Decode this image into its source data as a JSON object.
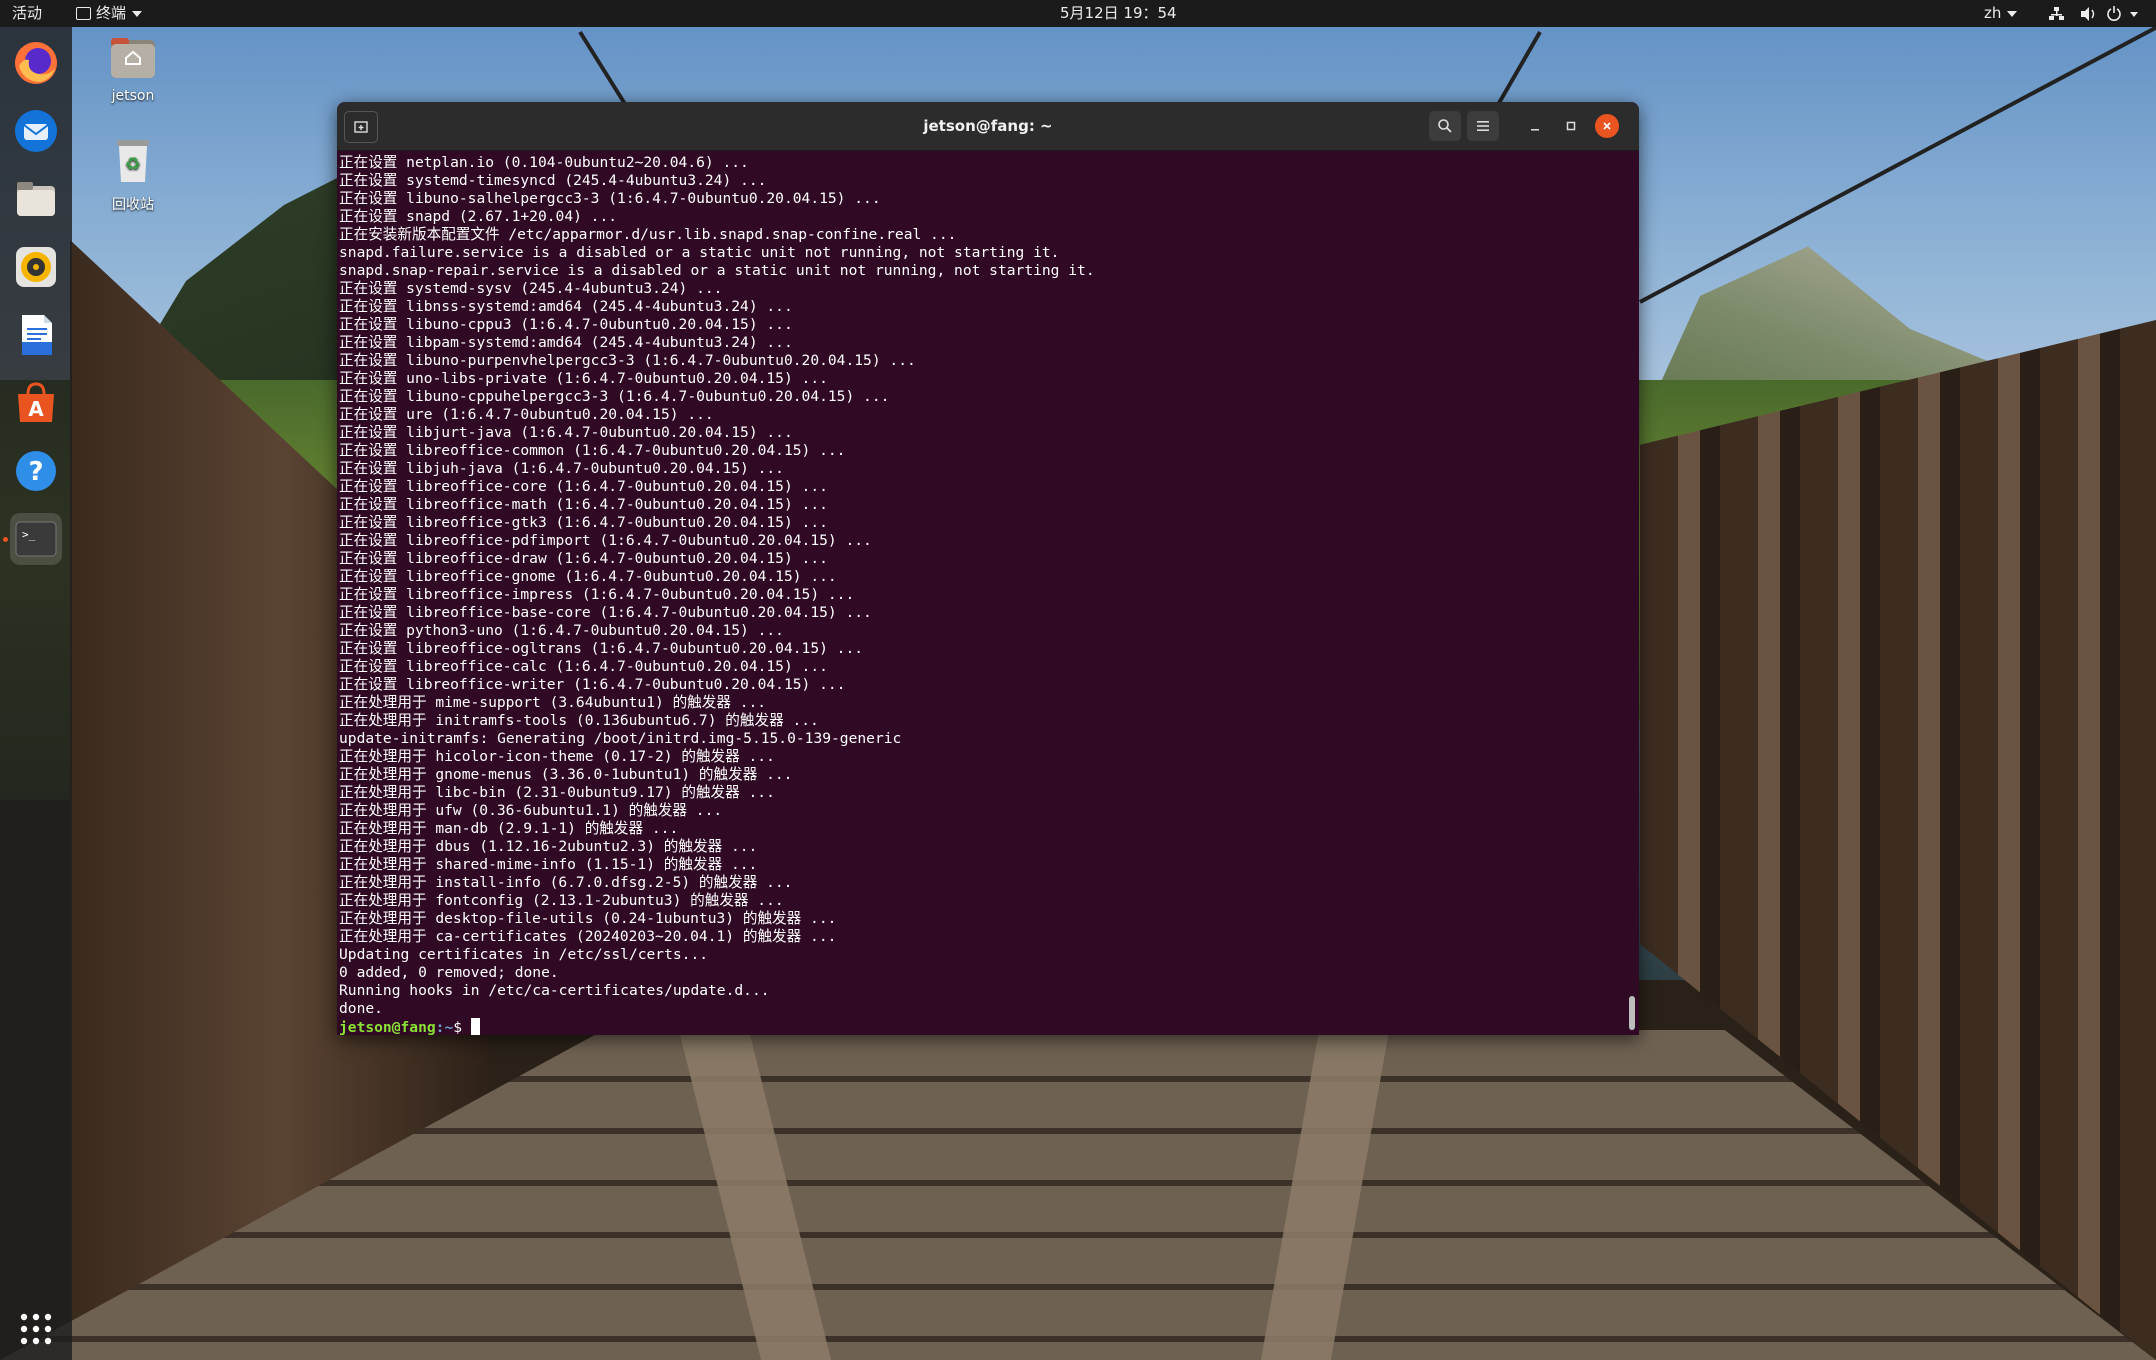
{
  "topbar": {
    "activities": "活动",
    "app_menu": "终端",
    "clock": "5月12日  19：54",
    "input_method": "zh"
  },
  "dock": {
    "items": [
      {
        "name": "firefox",
        "icon": "firefox-icon"
      },
      {
        "name": "thunderbird",
        "icon": "thunderbird-icon"
      },
      {
        "name": "files",
        "icon": "files-icon"
      },
      {
        "name": "rhythmbox",
        "icon": "rhythmbox-icon"
      },
      {
        "name": "libreoffice-writer",
        "icon": "writer-icon"
      },
      {
        "name": "ubuntu-software",
        "icon": "software-icon"
      },
      {
        "name": "help",
        "icon": "help-icon"
      },
      {
        "name": "terminal",
        "icon": "terminal-icon",
        "running": true
      }
    ],
    "show_apps": "apps-grid-icon"
  },
  "desktop": {
    "home_label": "jetson",
    "trash_label": "回收站"
  },
  "terminal": {
    "title": "jetson@fang: ~",
    "lines": [
      "正在设置 netplan.io (0.104-0ubuntu2~20.04.6) ...",
      "正在设置 systemd-timesyncd (245.4-4ubuntu3.24) ...",
      "正在设置 libuno-salhelpergcc3-3 (1:6.4.7-0ubuntu0.20.04.15) ...",
      "正在设置 snapd (2.67.1+20.04) ...",
      "正在安装新版本配置文件 /etc/apparmor.d/usr.lib.snapd.snap-confine.real ...",
      "snapd.failure.service is a disabled or a static unit not running, not starting it.",
      "snapd.snap-repair.service is a disabled or a static unit not running, not starting it.",
      "正在设置 systemd-sysv (245.4-4ubuntu3.24) ...",
      "正在设置 libnss-systemd:amd64 (245.4-4ubuntu3.24) ...",
      "正在设置 libuno-cppu3 (1:6.4.7-0ubuntu0.20.04.15) ...",
      "正在设置 libpam-systemd:amd64 (245.4-4ubuntu3.24) ...",
      "正在设置 libuno-purpenvhelpergcc3-3 (1:6.4.7-0ubuntu0.20.04.15) ...",
      "正在设置 uno-libs-private (1:6.4.7-0ubuntu0.20.04.15) ...",
      "正在设置 libuno-cppuhelpergcc3-3 (1:6.4.7-0ubuntu0.20.04.15) ...",
      "正在设置 ure (1:6.4.7-0ubuntu0.20.04.15) ...",
      "正在设置 libjurt-java (1:6.4.7-0ubuntu0.20.04.15) ...",
      "正在设置 libreoffice-common (1:6.4.7-0ubuntu0.20.04.15) ...",
      "正在设置 libjuh-java (1:6.4.7-0ubuntu0.20.04.15) ...",
      "正在设置 libreoffice-core (1:6.4.7-0ubuntu0.20.04.15) ...",
      "正在设置 libreoffice-math (1:6.4.7-0ubuntu0.20.04.15) ...",
      "正在设置 libreoffice-gtk3 (1:6.4.7-0ubuntu0.20.04.15) ...",
      "正在设置 libreoffice-pdfimport (1:6.4.7-0ubuntu0.20.04.15) ...",
      "正在设置 libreoffice-draw (1:6.4.7-0ubuntu0.20.04.15) ...",
      "正在设置 libreoffice-gnome (1:6.4.7-0ubuntu0.20.04.15) ...",
      "正在设置 libreoffice-impress (1:6.4.7-0ubuntu0.20.04.15) ...",
      "正在设置 libreoffice-base-core (1:6.4.7-0ubuntu0.20.04.15) ...",
      "正在设置 python3-uno (1:6.4.7-0ubuntu0.20.04.15) ...",
      "正在设置 libreoffice-ogltrans (1:6.4.7-0ubuntu0.20.04.15) ...",
      "正在设置 libreoffice-calc (1:6.4.7-0ubuntu0.20.04.15) ...",
      "正在设置 libreoffice-writer (1:6.4.7-0ubuntu0.20.04.15) ...",
      "正在处理用于 mime-support (3.64ubuntu1) 的触发器 ...",
      "正在处理用于 initramfs-tools (0.136ubuntu6.7) 的触发器 ...",
      "update-initramfs: Generating /boot/initrd.img-5.15.0-139-generic",
      "正在处理用于 hicolor-icon-theme (0.17-2) 的触发器 ...",
      "正在处理用于 gnome-menus (3.36.0-1ubuntu1) 的触发器 ...",
      "正在处理用于 libc-bin (2.31-0ubuntu9.17) 的触发器 ...",
      "正在处理用于 ufw (0.36-6ubuntu1.1) 的触发器 ...",
      "正在处理用于 man-db (2.9.1-1) 的触发器 ...",
      "正在处理用于 dbus (1.12.16-2ubuntu2.3) 的触发器 ...",
      "正在处理用于 shared-mime-info (1.15-1) 的触发器 ...",
      "正在处理用于 install-info (6.7.0.dfsg.2-5) 的触发器 ...",
      "正在处理用于 fontconfig (2.13.1-2ubuntu3) 的触发器 ...",
      "正在处理用于 desktop-file-utils (0.24-1ubuntu3) 的触发器 ...",
      "正在处理用于 ca-certificates (20240203~20.04.1) 的触发器 ...",
      "Updating certificates in /etc/ssl/certs...",
      "0 added, 0 removed; done.",
      "Running hooks in /etc/ca-certificates/update.d...",
      "done."
    ],
    "prompt_user": "jetson@fang",
    "prompt_path": ":~",
    "prompt_symbol": "$ "
  },
  "colors": {
    "terminal_bg": "#300a24",
    "prompt_user": "#8ae234",
    "prompt_path": "#729fcf",
    "close_button": "#e95420"
  }
}
